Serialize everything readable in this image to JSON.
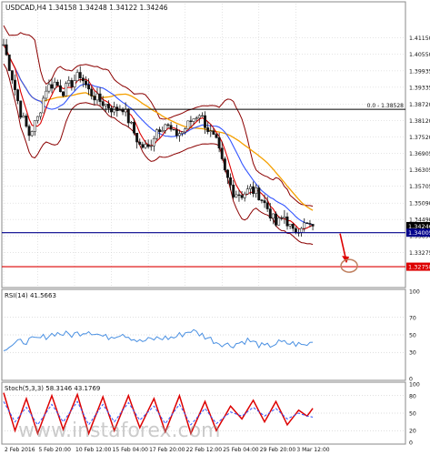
{
  "header": {
    "main": "USDCAD,H4  1.34158 1.34248 1.34122 1.34246",
    "rsi": "RSI(14) 41.5663",
    "stoch": "Stoch(5,3,3) 58.3146 43.1769"
  },
  "watermark": "www.instaforex.com",
  "colors": {
    "price": "#111111",
    "bb": "#8b0000",
    "ma_orange": "#f5a000",
    "ma_blue": "#3355ff",
    "ma_red": "#dd0000",
    "rsi": "#4a90e2",
    "stoch_main": "#dd0000",
    "stoch_signal": "#3355ff",
    "hline_black": "#000000",
    "hline_blue": "#00008b",
    "hline_red": "#dd0000",
    "arrow": "#dd0000",
    "circle": "#c08060",
    "current_box": "#000000",
    "support_box": "#00008b",
    "target_box": "#dd0000"
  },
  "price_panel": {
    "y_range": [
      1.3206,
      1.424
    ],
    "ticks": [
      "1.41150",
      "1.40550",
      "1.39935",
      "1.39335",
      "1.38720",
      "1.38120",
      "1.37520",
      "1.36905",
      "1.36305",
      "1.35705",
      "1.35090",
      "1.34490",
      "1.33890",
      "1.33275"
    ],
    "tick_values": [
      1.4115,
      1.4055,
      1.39935,
      1.39335,
      1.3872,
      1.3812,
      1.3752,
      1.36905,
      1.36305,
      1.35705,
      1.3509,
      1.3449,
      1.3389,
      1.33275
    ],
    "fib_label": "0.0 - 1.38528",
    "current_label": "1.34246",
    "support_label": "1.34005",
    "target_label": "1.32758",
    "levels": {
      "fib": 1.38528,
      "support": 1.34005,
      "target": 1.32758,
      "current": 1.34246
    }
  },
  "rsi_panel": {
    "ticks": [
      "100",
      "70",
      "50",
      "30",
      "0"
    ],
    "tick_values": [
      100,
      70,
      50,
      30,
      0
    ]
  },
  "stoch_panel": {
    "ticks": [
      "100",
      "80",
      "50",
      "20",
      "0"
    ],
    "tick_values": [
      100,
      80,
      50,
      20,
      0
    ]
  },
  "x_axis": {
    "labels": [
      "2 Feb 2016",
      "5 Feb 20:00",
      "10 Feb 12:00",
      "15 Feb 04:00",
      "17 Feb 20:00",
      "22 Feb 12:00",
      "25 Feb 04:00",
      "29 Feb 20:00",
      "3 Mar 12:00"
    ],
    "label_bars": [
      0,
      12,
      25,
      38,
      51,
      64,
      77,
      90,
      103
    ]
  },
  "chart_data": {
    "type": "line",
    "symbol": "USDCAD",
    "timeframe": "H4",
    "bars": 110,
    "close_anchors": [
      [
        0,
        1.409
      ],
      [
        3,
        1.397
      ],
      [
        6,
        1.384
      ],
      [
        9,
        1.376
      ],
      [
        12,
        1.382
      ],
      [
        15,
        1.393
      ],
      [
        18,
        1.395
      ],
      [
        21,
        1.392
      ],
      [
        24,
        1.395
      ],
      [
        27,
        1.398
      ],
      [
        30,
        1.392
      ],
      [
        33,
        1.389
      ],
      [
        36,
        1.387
      ],
      [
        39,
        1.385
      ],
      [
        42,
        1.386
      ],
      [
        45,
        1.379
      ],
      [
        48,
        1.372
      ],
      [
        51,
        1.371
      ],
      [
        54,
        1.378
      ],
      [
        57,
        1.38
      ],
      [
        60,
        1.376
      ],
      [
        63,
        1.377
      ],
      [
        66,
        1.381
      ],
      [
        69,
        1.384
      ],
      [
        72,
        1.378
      ],
      [
        75,
        1.373
      ],
      [
        78,
        1.362
      ],
      [
        81,
        1.355
      ],
      [
        84,
        1.354
      ],
      [
        87,
        1.356
      ],
      [
        90,
        1.354
      ],
      [
        93,
        1.349
      ],
      [
        96,
        1.343
      ],
      [
        99,
        1.346
      ],
      [
        102,
        1.34
      ],
      [
        105,
        1.343
      ],
      [
        108,
        1.3425
      ],
      [
        109,
        1.34246
      ]
    ],
    "rsi_anchors": [
      [
        0,
        35
      ],
      [
        6,
        42
      ],
      [
        12,
        45
      ],
      [
        18,
        52
      ],
      [
        24,
        50
      ],
      [
        30,
        55
      ],
      [
        36,
        47
      ],
      [
        42,
        52
      ],
      [
        48,
        42
      ],
      [
        54,
        46
      ],
      [
        60,
        47
      ],
      [
        66,
        55
      ],
      [
        70,
        50
      ],
      [
        75,
        42
      ],
      [
        80,
        38
      ],
      [
        86,
        44
      ],
      [
        92,
        36
      ],
      [
        97,
        41
      ],
      [
        102,
        40
      ],
      [
        106,
        38
      ],
      [
        109,
        41.5663
      ]
    ],
    "stoch_main_anchors": [
      [
        0,
        85
      ],
      [
        4,
        20
      ],
      [
        8,
        75
      ],
      [
        12,
        15
      ],
      [
        17,
        80
      ],
      [
        21,
        22
      ],
      [
        26,
        82
      ],
      [
        30,
        15
      ],
      [
        35,
        78
      ],
      [
        39,
        20
      ],
      [
        44,
        80
      ],
      [
        48,
        25
      ],
      [
        53,
        75
      ],
      [
        57,
        18
      ],
      [
        62,
        80
      ],
      [
        66,
        15
      ],
      [
        71,
        70
      ],
      [
        75,
        20
      ],
      [
        80,
        62
      ],
      [
        84,
        40
      ],
      [
        88,
        72
      ],
      [
        92,
        35
      ],
      [
        96,
        70
      ],
      [
        100,
        30
      ],
      [
        104,
        55
      ],
      [
        107,
        45
      ],
      [
        109,
        58.3146
      ]
    ],
    "stoch_signal_anchors": [
      [
        0,
        70
      ],
      [
        4,
        35
      ],
      [
        8,
        60
      ],
      [
        12,
        30
      ],
      [
        17,
        65
      ],
      [
        21,
        35
      ],
      [
        26,
        70
      ],
      [
        30,
        30
      ],
      [
        35,
        65
      ],
      [
        39,
        35
      ],
      [
        44,
        68
      ],
      [
        48,
        38
      ],
      [
        53,
        62
      ],
      [
        57,
        32
      ],
      [
        62,
        65
      ],
      [
        66,
        30
      ],
      [
        71,
        58
      ],
      [
        75,
        32
      ],
      [
        80,
        52
      ],
      [
        84,
        45
      ],
      [
        88,
        60
      ],
      [
        92,
        45
      ],
      [
        96,
        58
      ],
      [
        100,
        40
      ],
      [
        104,
        50
      ],
      [
        107,
        45
      ],
      [
        109,
        43.1769
      ]
    ]
  }
}
